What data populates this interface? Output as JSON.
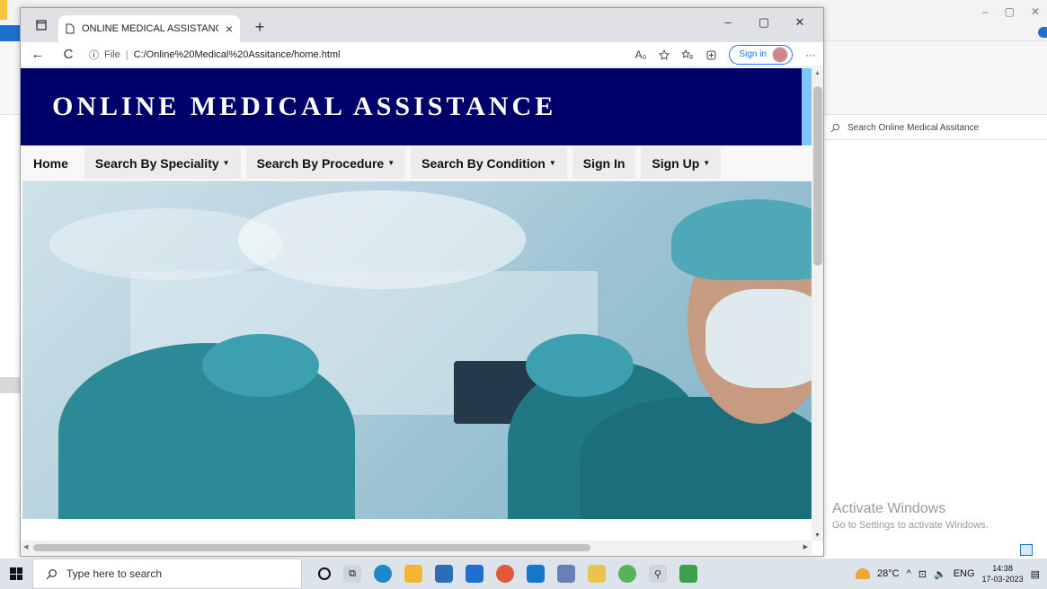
{
  "browser": {
    "tab_title": "ONLINE MEDICAL ASSISTANCE -",
    "tab_close": "×",
    "new_tab": "+",
    "win_minimize": "–",
    "win_maximize": "▢",
    "win_close": "✕",
    "back": "←",
    "refresh": "C",
    "info": "ⓘ",
    "file_label": "File",
    "separator": "|",
    "url": "C:/Online%20Medical%20Assitance/home.html",
    "read_aloud": "A₀",
    "signin_label": "Sign in",
    "more": "···"
  },
  "site": {
    "title": "ONLINE MEDICAL ASSISTANCE",
    "nav": [
      {
        "label": "Home",
        "caret": ""
      },
      {
        "label": "Search By Speciality",
        "caret": "▼"
      },
      {
        "label": "Search By Procedure",
        "caret": "▼"
      },
      {
        "label": "Search By Condition",
        "caret": "▼"
      },
      {
        "label": "Sign In",
        "caret": ""
      },
      {
        "label": "Sign Up",
        "caret": "▼"
      }
    ]
  },
  "background_app": {
    "search_placeholder": "Search Online Medical Assitance",
    "min": "–",
    "max": "▢",
    "close": "✕",
    "activate_line1": "Activate Windows",
    "activate_line2": "Go to Settings to activate Windows."
  },
  "taskbar": {
    "search_placeholder": "Type here to search",
    "temperature": "28°C",
    "language": "ENG",
    "time": "14:38",
    "date": "17-03-2023"
  },
  "colors": {
    "header_bg": "#00006b",
    "accent": "#1a73e8"
  }
}
